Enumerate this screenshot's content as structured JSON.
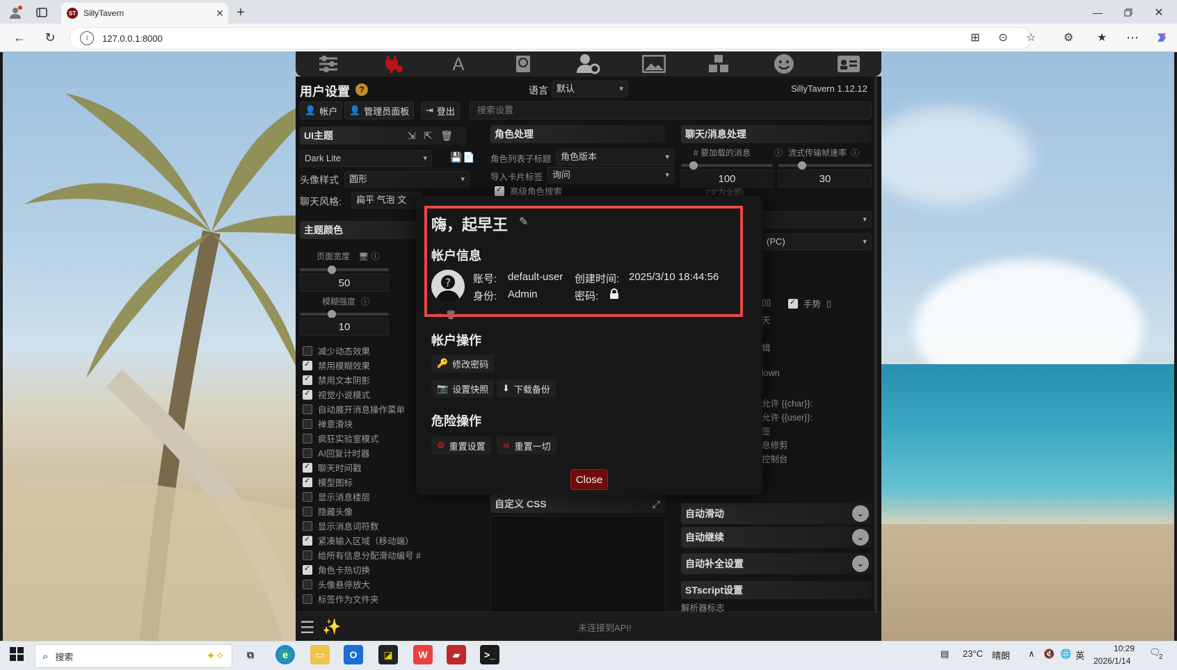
{
  "browser": {
    "tab_title": "SillyTavern",
    "favicon_text": "ST",
    "url": "127.0.0.1:8000"
  },
  "panel": {
    "title": "用户设置",
    "help": "?",
    "language_label": "语言",
    "language_value": "默认",
    "version": "SillyTavern 1.12.12",
    "buttons": {
      "account": "帐户",
      "admin": "管理员面板",
      "logout": "登出"
    },
    "search_placeholder": "搜索设置"
  },
  "left": {
    "ui_theme_header": "UI主题",
    "theme_value": "Dark Lite",
    "avatar_style_label": "头像样式",
    "avatar_style_value": "圆形",
    "chat_style_label": "聊天风格:",
    "chat_style_value": "扁平 气泡 文",
    "theme_colors_header": "主题颜色",
    "page_width_label": "页面宽度",
    "page_width_value": "50",
    "blur_label": "模糊强度",
    "blur_value": "10",
    "checkboxes": [
      {
        "label": "减少动态效果",
        "checked": false
      },
      {
        "label": "禁用模糊效果",
        "checked": true
      },
      {
        "label": "禁用文本阴影",
        "checked": true
      },
      {
        "label": "视觉小说模式",
        "checked": true
      },
      {
        "label": "自动展开消息操作菜单",
        "checked": false
      },
      {
        "label": "禅意滑块",
        "checked": false
      },
      {
        "label": "疯狂实验室模式",
        "checked": false
      },
      {
        "label": "AI回复计时器",
        "checked": false
      },
      {
        "label": "聊天时间戳",
        "checked": true
      },
      {
        "label": "模型图标",
        "checked": true
      },
      {
        "label": "显示消息楼层",
        "checked": false
      },
      {
        "label": "隐藏头像",
        "checked": false
      },
      {
        "label": "显示消息词符数",
        "checked": false
      },
      {
        "label": "紧凑输入区域（移动端）",
        "checked": true
      },
      {
        "label": "给所有信息分配滑动编号 #",
        "checked": false
      },
      {
        "label": "角色卡热切换",
        "checked": true
      },
      {
        "label": "头像悬停放大",
        "checked": false
      },
      {
        "label": "标签作为文件夹",
        "checked": false
      }
    ]
  },
  "middle": {
    "char_header": "角色处理",
    "list_sub_label": "角色列表子标题",
    "list_sub_value": "角色版本",
    "import_tags_label": "导入卡片标签",
    "import_tags_value": "询问",
    "advanced_search": "高级角色搜索",
    "custom_css_header": "自定义 CSS"
  },
  "right": {
    "chat_header": "聊天/消息处理",
    "msg_load_label": "# 要加载的消息",
    "msg_load_value": "100",
    "stream_label": "流式传输帧速率",
    "stream_value": "30",
    "zero_all": "(\"0\"为全部)",
    "pc_value": "(PC)",
    "gesture": "手势",
    "frag_1": "天",
    "frag_2": "辑",
    "frag_3": "lown",
    "frag_4": "允许 {{char}}:",
    "frag_5": "允许 {{user}}:",
    "frag_6": "签",
    "frag_7": "息修剪",
    "frag_8": "控制台",
    "auto_scroll": "自动滑动",
    "auto_continue": "自动继续",
    "autocomplete": "自动补全设置",
    "stscript": "STscript设置",
    "parser_flags": "解析器标志"
  },
  "bottom": {
    "status": "未连接到API!"
  },
  "modal": {
    "greeting": "嗨，起早王",
    "account_info_header": "帐户信息",
    "account_label": "账号:",
    "account_value": "default-user",
    "created_label": "创建时间:",
    "created_value": "2025/3/10 18:44:56",
    "role_label": "身份:",
    "role_value": "Admin",
    "password_label": "密码:",
    "account_ops_header": "帐户操作",
    "change_password": "修改密码",
    "snapshot": "设置快照",
    "download_backup": "下载备份",
    "danger_header": "危险操作",
    "reset_settings": "重置设置",
    "reset_everything": "重置一切",
    "close": "Close"
  },
  "taskbar": {
    "search": "搜索",
    "weather_temp": "23°C",
    "weather_desc": "晴朗",
    "ime": "英",
    "time": "10:29",
    "date": "2026/1/14",
    "notification_count": "2"
  },
  "colors": {
    "highlight_border": "#e84848",
    "close_button": "#6e0c0c",
    "panel_bg": "#141414"
  }
}
